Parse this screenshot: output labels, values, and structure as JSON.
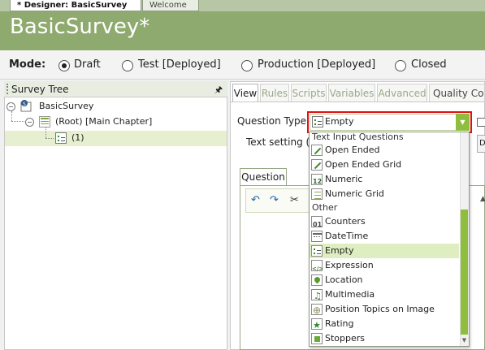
{
  "doc_tabs": [
    {
      "label": "* Designer: BasicSurvey",
      "active": true
    },
    {
      "label": "Welcome",
      "active": false
    }
  ],
  "header": {
    "title": "BasicSurvey*"
  },
  "mode": {
    "label": "Mode:",
    "options": [
      {
        "label": "Draft",
        "checked": true
      },
      {
        "label": "Test [Deployed]",
        "checked": false
      },
      {
        "label": "Production [Deployed]",
        "checked": false
      },
      {
        "label": "Closed",
        "checked": false
      }
    ]
  },
  "survey_tree": {
    "title": "Survey Tree",
    "pin_icon": "pin-icon",
    "nodes": [
      {
        "label": "BasicSurvey",
        "icon": "survey-icon"
      },
      {
        "label": "(Root) [Main Chapter]",
        "icon": "chapter-icon"
      },
      {
        "label": "(1)",
        "icon": "question-icon",
        "selected": true
      }
    ]
  },
  "right_tabs": [
    "View",
    "Rules",
    "Scripts",
    "Variables",
    "Advanced",
    "Quality Cont"
  ],
  "question_type": {
    "label": "Question Type:",
    "value": "Empty"
  },
  "text_setting": {
    "label": "Text setting (Pl",
    "button": "D"
  },
  "question_tab": "Question",
  "dropdown": {
    "groups": [
      {
        "name": "Text Input Questions",
        "items": [
          {
            "label": "Open Ended",
            "icon": "open-ended-icon"
          },
          {
            "label": "Open Ended Grid",
            "icon": "open-ended-grid-icon"
          },
          {
            "label": "Numeric",
            "icon": "numeric-icon"
          },
          {
            "label": "Numeric Grid",
            "icon": "numeric-grid-icon"
          }
        ]
      },
      {
        "name": "Other",
        "items": [
          {
            "label": "Counters",
            "icon": "counters-icon"
          },
          {
            "label": "DateTime",
            "icon": "datetime-icon"
          },
          {
            "label": "Empty",
            "icon": "empty-icon",
            "selected": true
          },
          {
            "label": "Expression",
            "icon": "expression-icon"
          },
          {
            "label": "Location",
            "icon": "location-icon"
          },
          {
            "label": "Multimedia",
            "icon": "multimedia-icon"
          },
          {
            "label": "Position Topics on Image",
            "icon": "position-topics-icon"
          },
          {
            "label": "Rating",
            "icon": "rating-icon"
          },
          {
            "label": "Stoppers",
            "icon": "stoppers-icon"
          }
        ]
      }
    ]
  },
  "colors": {
    "header_bg": "#8faa6e",
    "accent_green": "#8fbd3d",
    "highlight_red": "#e01010",
    "selected_row": "#dfeec0"
  }
}
